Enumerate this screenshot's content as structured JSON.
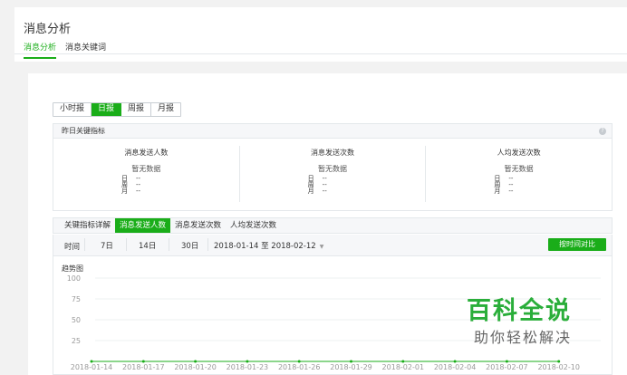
{
  "header": {
    "title": "消息分析",
    "tabs": [
      {
        "label": "消息分析",
        "active": true
      },
      {
        "label": "消息关键词",
        "active": false
      }
    ]
  },
  "period": {
    "options": [
      "小时报",
      "日报",
      "周报",
      "月报"
    ],
    "selected": "日报"
  },
  "kpi": {
    "title": "昨日关键指标",
    "help_icon": "question-circle-icon",
    "metrics": [
      {
        "name": "消息发送人数",
        "no_data": "暂无数据",
        "rows": [
          {
            "label": "日",
            "value": "--"
          },
          {
            "label": "周",
            "value": "--"
          },
          {
            "label": "月",
            "value": "--"
          }
        ]
      },
      {
        "name": "消息发送次数",
        "no_data": "暂无数据",
        "rows": [
          {
            "label": "日",
            "value": "--"
          },
          {
            "label": "周",
            "value": "--"
          },
          {
            "label": "月",
            "value": "--"
          }
        ]
      },
      {
        "name": "人均发送次数",
        "no_data": "暂无数据",
        "rows": [
          {
            "label": "日",
            "value": "--"
          },
          {
            "label": "周",
            "value": "--"
          },
          {
            "label": "月",
            "value": "--"
          }
        ]
      }
    ]
  },
  "detail": {
    "tabs": [
      "关键指标详解",
      "消息发送人数",
      "消息发送次数",
      "人均发送次数"
    ],
    "active_tab": "消息发送人数"
  },
  "filter": {
    "label": "时间",
    "ranges": [
      "7日",
      "14日",
      "30日"
    ],
    "date_range": "2018-01-14 至 2018-02-12",
    "compare_label": "按时间对比"
  },
  "chart_data": {
    "type": "line",
    "title": "趋势图",
    "y_ticks": [
      25,
      50,
      75,
      100
    ],
    "ylim": [
      0,
      100
    ],
    "x_ticks": [
      "2018-01-14",
      "2018-01-17",
      "2018-01-20",
      "2018-01-23",
      "2018-01-26",
      "2018-01-29",
      "2018-02-01",
      "2018-02-04",
      "2018-02-07",
      "2018-02-10"
    ],
    "grid": true,
    "line_color": "#1aad19"
  },
  "watermark": {
    "main": "百科全说",
    "sub": "助你轻松解决"
  },
  "colors": {
    "accent": "#1aad19"
  }
}
